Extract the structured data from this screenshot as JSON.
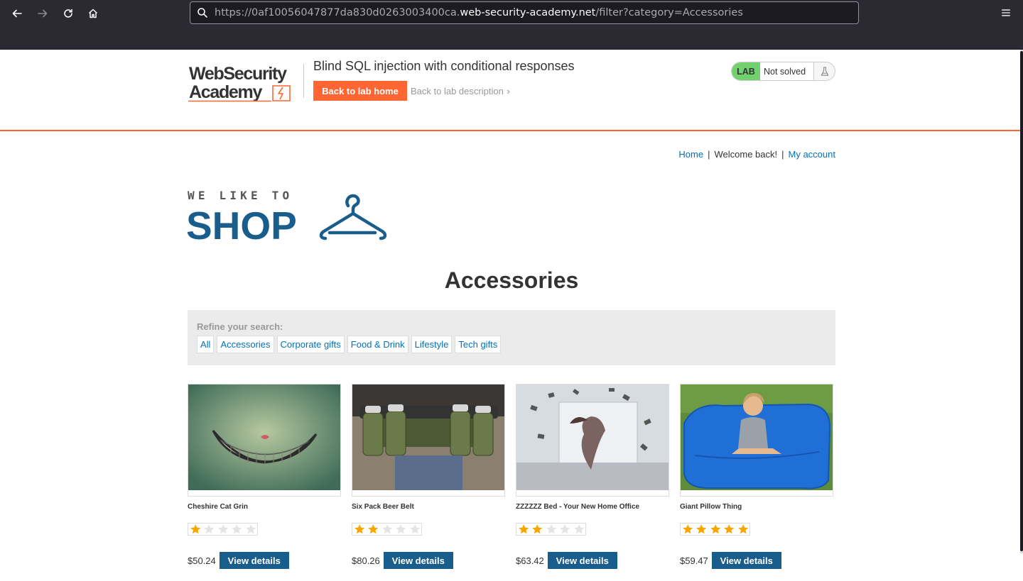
{
  "browser": {
    "url_prefix": "https://0af10056047877da830d0263003400ca.",
    "url_domain": "web-security-academy.net",
    "url_path": "/filter?category=Accessories"
  },
  "lab": {
    "logo_line1": "WebSecurity",
    "logo_line2": "Academy",
    "title": "Blind SQL injection with conditional responses",
    "back_home_label": "Back to lab home",
    "back_description_label": "Back to lab description",
    "status_badge": "LAB",
    "status_text": "Not solved"
  },
  "account_nav": {
    "home": "Home",
    "separator": "|",
    "welcome": "Welcome back!",
    "my_account": "My account"
  },
  "shop_logo": {
    "line1": "WE LIKE TO",
    "line2": "SHOP"
  },
  "page": {
    "title": "Accessories"
  },
  "filters": {
    "label": "Refine your search:",
    "items": [
      "All",
      "Accessories",
      "Corporate gifts",
      "Food & Drink",
      "Lifestyle",
      "Tech gifts"
    ]
  },
  "products": [
    {
      "name": "Cheshire Cat Grin",
      "rating": 1,
      "price": "$50.24",
      "button": "View details"
    },
    {
      "name": "Six Pack Beer Belt",
      "rating": 2,
      "price": "$80.26",
      "button": "View details"
    },
    {
      "name": "ZZZZZZ Bed - Your New Home Office",
      "rating": 2,
      "price": "$63.42",
      "button": "View details"
    },
    {
      "name": "Giant Pillow Thing",
      "rating": 5,
      "price": "$59.47",
      "button": "View details"
    }
  ],
  "colors": {
    "accent_orange": "#ff6633",
    "link_blue": "#0071bc",
    "button_blue": "#185d8b",
    "shop_teal": "#185d8b",
    "lab_green": "#70d16d",
    "star_gold": "#f7a600"
  },
  "icons": [
    "back-arrow-icon",
    "forward-arrow-icon",
    "reload-icon",
    "home-icon",
    "search-icon",
    "hamburger-menu-icon",
    "flask-icon",
    "chevron-double-right-icon",
    "star-icon"
  ]
}
